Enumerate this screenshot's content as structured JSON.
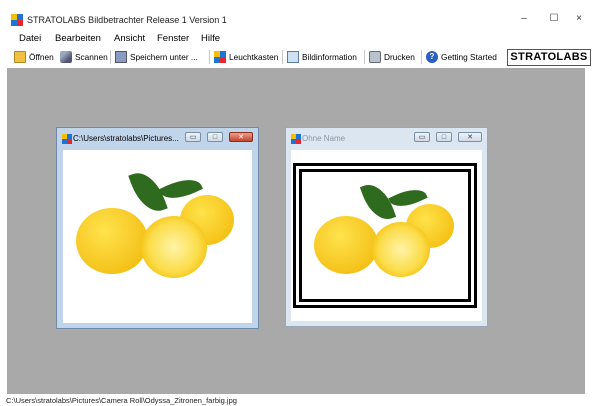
{
  "app": {
    "title": "STRATOLABS Bildbetrachter Release 1 Version 1",
    "window_controls": {
      "minimize": "–",
      "maximize": "☐",
      "close": "×"
    }
  },
  "menu": [
    "Datei",
    "Bearbeiten",
    "Ansicht",
    "Fenster",
    "Hilfe"
  ],
  "toolbar": {
    "open": "Öffnen",
    "scan": "Scannen",
    "save_as": "Speichern unter ...",
    "lightbox": "Leuchtkasten",
    "image_info": "Bildinformation",
    "print": "Drucken",
    "getting_started": "Getting Started",
    "brand": "STRATOLABS"
  },
  "windows": [
    {
      "title": "C:\\Users\\stratolabs\\Pictures...",
      "active": true,
      "controls": [
        "▭",
        "□",
        "✕"
      ]
    },
    {
      "title": "Ohne Name",
      "active": false,
      "controls": [
        "▭",
        "□",
        "✕"
      ]
    }
  ],
  "status": {
    "path": "C:\\Users\\stratolabs\\Pictures\\Camera Roll\\Odyssa_Zitronen_farbig.jpg"
  },
  "colors": {
    "workspace": "#a9a9a9",
    "lemon": "#f4c20d",
    "leaf": "#2f6b1e",
    "frame": "#000000"
  }
}
